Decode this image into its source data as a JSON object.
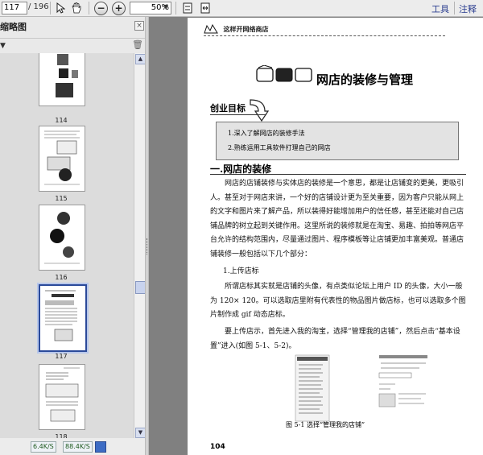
{
  "toolbar": {
    "page_current": "117",
    "page_total": "/ 196",
    "zoom": "50%",
    "tools_label": "工具",
    "comment_label": "注释"
  },
  "panel": {
    "title": "缩略图",
    "thumbnails": [
      {
        "page": "114"
      },
      {
        "page": "115"
      },
      {
        "page": "116"
      },
      {
        "page": "117"
      },
      {
        "page": "118"
      }
    ],
    "bottom_buttons": [
      "6.4K/S",
      "88.4K/S"
    ]
  },
  "document": {
    "running_header": "这样开网络商店",
    "chapter_title": "网店的装修与管理",
    "goal_heading": "创业目标",
    "goals": [
      "1.深入了解网店的装修手法",
      "2.熟练运用工具软件打理自己的网店"
    ],
    "section_heading": "一.网店的装修",
    "para1": "网店的店铺装修与实体店的装修是一个意思，都是让店铺变的更美，更吸引人。甚至对于网店来讲，一个好的店铺设计更为至关重要，因为客户只能从网上的文字和图片来了解产品，所以装得好能增加用户的信任感，甚至还能对自己店铺品牌的树立起到关键作用。这里所说的装修就是在淘宝、易趣、拍拍等网店平台允许的结构范围内，尽量通过图片、程序模板等让店铺更加丰富美观。普通店铺装修一般包括以下几个部分：",
    "subheading": "1.上传店标",
    "para2": "所谓店标其实就是店铺的头像，有点类似论坛上用户 ID 的头像，大小一般为 120× 120。可以选取店里附有代表性的物品图片做店标，也可以选取多个图片制作成 gif 动态店标。",
    "para3": "要上传店示，首先进入我的淘宝，选择“管理我的店铺”，然后点击“基本设置”进入(如图 5-1、5-2)。",
    "figure_caption": "图 5-1 选择“管理我的店铺”",
    "page_number": "104"
  }
}
